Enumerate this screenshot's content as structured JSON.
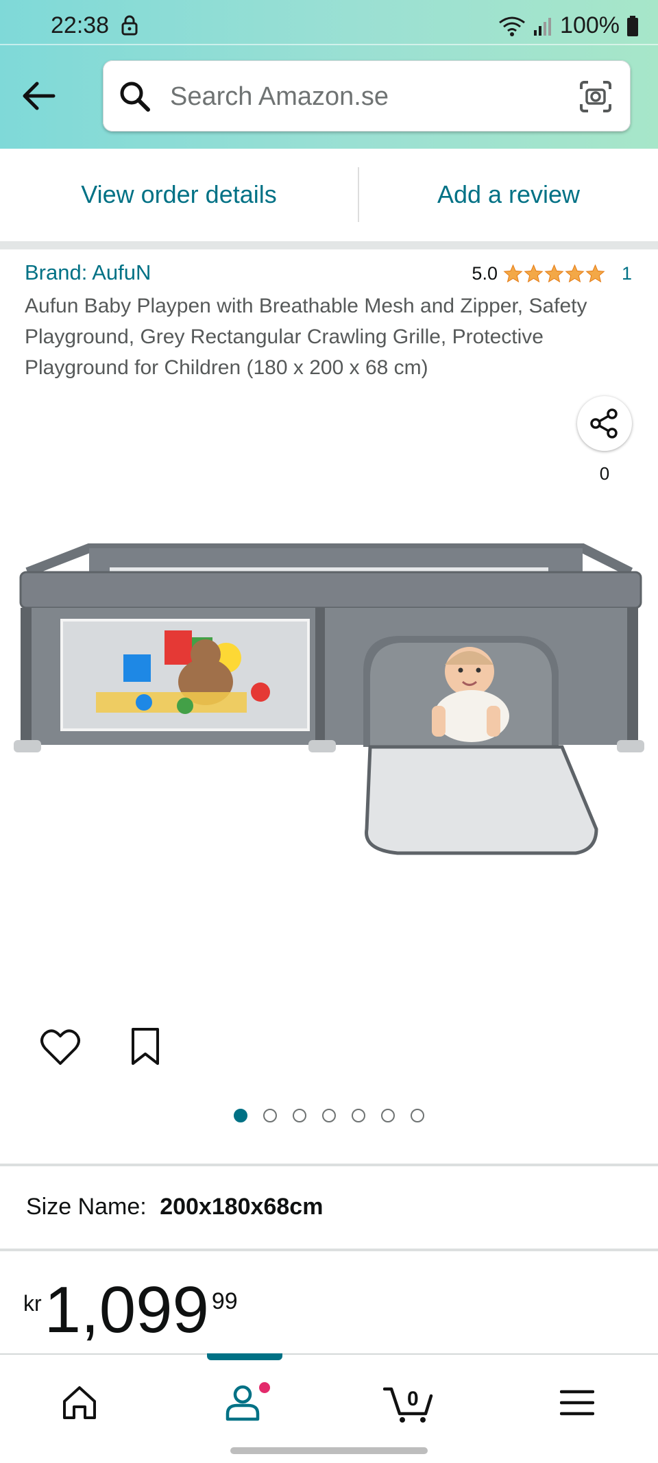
{
  "status_bar": {
    "time": "22:38",
    "battery": "100%"
  },
  "header": {
    "search_placeholder": "Search Amazon.se"
  },
  "order_actions": {
    "view_order": "View order details",
    "add_review": "Add a review"
  },
  "product": {
    "brand": "Brand: AufuN",
    "rating": "5.0",
    "rating_stars": 5,
    "rating_count": "1",
    "title": "Aufun Baby Playpen with Breathable Mesh and Zipper, Safety Playground, Grey Rectangular Crawling Grille, Protective Playground for Children (180 x 200 x 68 cm)",
    "share_count": "0",
    "image_count": 7,
    "active_image": 1,
    "size_label": "Size Name:",
    "size_value": "200x180x68cm",
    "price_currency": "kr",
    "price_whole": "1,099",
    "price_fraction": "99"
  },
  "bottom_nav": {
    "cart_count": "0",
    "items": [
      "home-icon",
      "account-icon",
      "cart-icon",
      "menu-icon"
    ]
  },
  "colors": {
    "link": "#007185",
    "star": "#f3a847",
    "badge": "#e32a6b"
  }
}
